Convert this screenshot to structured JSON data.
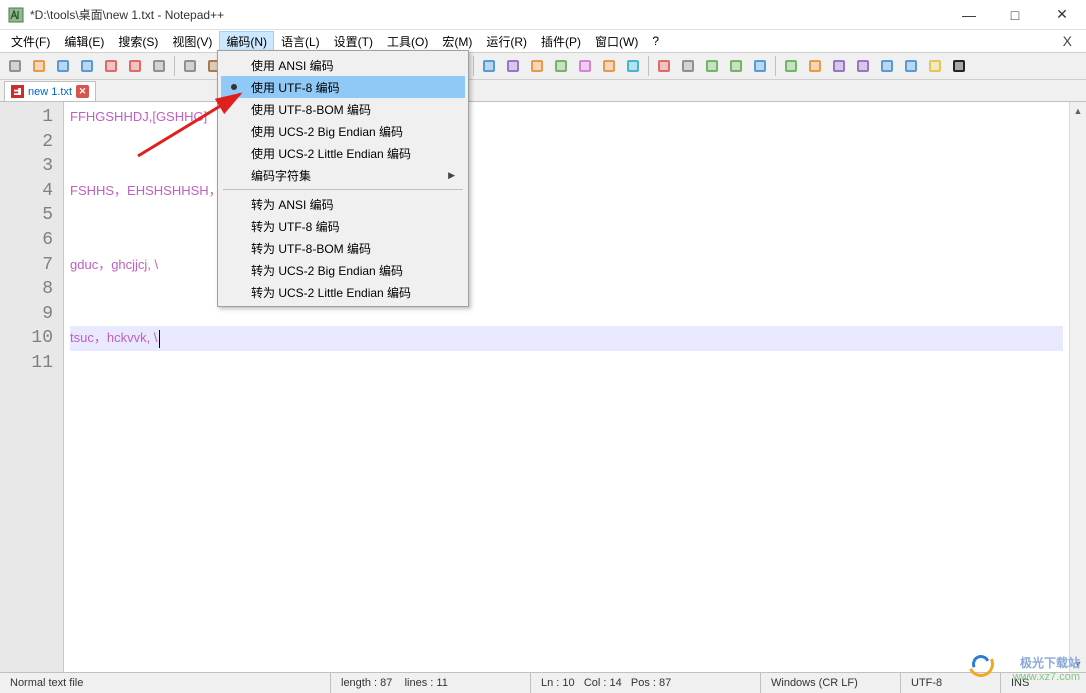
{
  "window": {
    "title": "*D:\\tools\\桌面\\new 1.txt - Notepad++"
  },
  "menubar": {
    "file": "文件(F)",
    "edit": "编辑(E)",
    "search": "搜索(S)",
    "view": "视图(V)",
    "encoding": "编码(N)",
    "language": "语言(L)",
    "settings": "设置(T)",
    "tools": "工具(O)",
    "macro": "宏(M)",
    "run": "运行(R)",
    "plugins": "插件(P)",
    "window": "窗口(W)",
    "help": "?"
  },
  "encoding_menu": {
    "use_ansi": "使用 ANSI 编码",
    "use_utf8": "使用 UTF-8 编码",
    "use_utf8_bom": "使用 UTF-8-BOM 编码",
    "use_ucs2_be": "使用 UCS-2 Big Endian 编码",
    "use_ucs2_le": "使用 UCS-2 Little Endian 编码",
    "charset": "编码字符集",
    "to_ansi": "转为 ANSI 编码",
    "to_utf8": "转为 UTF-8 编码",
    "to_utf8_bom": "转为 UTF-8-BOM 编码",
    "to_ucs2_be": "转为 UCS-2 Big Endian 编码",
    "to_ucs2_le": "转为 UCS-2 Little Endian 编码"
  },
  "tabs": {
    "tab1": "new 1.txt"
  },
  "lines": [
    "1",
    "2",
    "3",
    "4",
    "5",
    "6",
    "7",
    "8",
    "9",
    "10",
    "11"
  ],
  "content": {
    "l1": "FFHGSHHDJ,[GSHHG]",
    "l2": "",
    "l3": "",
    "l4": "FSHHS，EHSHSHHSH，",
    "l5": "",
    "l6": "",
    "l7": "gduc，ghcjjcj, \\",
    "l8": "",
    "l9": "",
    "l10": "tsuc，hckvvk, \\",
    "l11": ""
  },
  "status": {
    "filetype": "Normal text file",
    "length": "length : 87",
    "lines": "lines : 11",
    "ln": "Ln : 10",
    "col": "Col : 14",
    "pos": "Pos : 87",
    "eol": "Windows (CR LF)",
    "enc": "UTF-8",
    "ins": "INS"
  },
  "toolbar_icons": [
    "new-file-icon",
    "open-file-icon",
    "save-icon",
    "save-all-icon",
    "close-icon",
    "close-all-icon",
    "print-icon",
    "sep",
    "cut-icon",
    "copy-icon",
    "paste-icon",
    "sep",
    "undo-icon",
    "redo-icon",
    "sep",
    "find-icon",
    "replace-icon",
    "sep",
    "zoom-in-icon",
    "zoom-out-icon",
    "sep",
    "sync-v-icon",
    "sync-h-icon",
    "sep",
    "wordwrap-icon",
    "show-all-icon",
    "indent-guide-icon",
    "language-icon",
    "doc-map-icon",
    "folder-icon",
    "monitor-icon",
    "sep",
    "record-icon",
    "stop-icon",
    "play-icon",
    "play-multi-icon",
    "save-macro-icon",
    "sep",
    "spell-icon",
    "compare-icon",
    "shift-left-icon",
    "shift-right-icon",
    "sort-asc-icon",
    "sort-desc-icon",
    "bookmark-icon",
    "bold-icon"
  ],
  "colors": {
    "blue": "#3b8bd4",
    "orange": "#e78a2f",
    "green": "#5fa94e",
    "red": "#d9534f",
    "purple": "#8860c0",
    "gray": "#808080",
    "cyan": "#2aa8c9",
    "brown": "#996633",
    "pink": "#d070d0",
    "yellow": "#e0c040"
  },
  "watermark": {
    "brand": "极光下载站",
    "url": "www.xz7.com"
  }
}
